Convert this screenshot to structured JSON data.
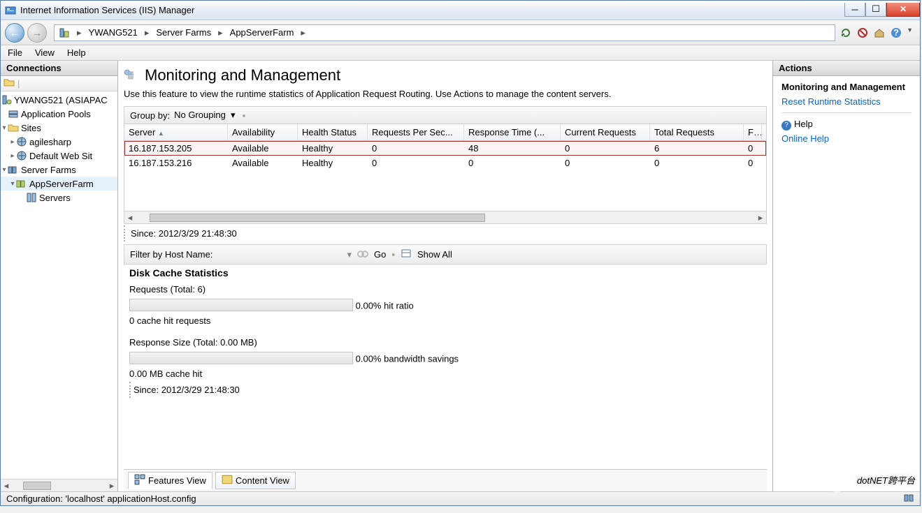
{
  "window": {
    "title": "Internet Information Services (IIS) Manager"
  },
  "breadcrumb": {
    "segments": [
      "YWANG521",
      "Server Farms",
      "AppServerFarm"
    ]
  },
  "menubar": {
    "file": "File",
    "view": "View",
    "help": "Help"
  },
  "connections": {
    "title": "Connections",
    "root": "YWANG521 (ASIAPAC",
    "app_pools": "Application Pools",
    "sites": "Sites",
    "site1": "agilesharp",
    "site2": "Default Web Sit",
    "server_farms": "Server Farms",
    "farm1": "AppServerFarm",
    "servers": "Servers"
  },
  "content": {
    "title": "Monitoring and Management",
    "subtitle": "Use this feature to view the runtime statistics of Application Request Routing. Use Actions to manage the content servers.",
    "group_by_label": "Group by:",
    "group_by_value": "No Grouping",
    "columns": [
      "Server",
      "Availability",
      "Health Status",
      "Requests Per Sec...",
      "Response Time (...",
      "Current Requests",
      "Total Requests",
      "Fai"
    ],
    "rows": [
      {
        "server": "16.187.153.205",
        "availability": "Available",
        "health": "Healthy",
        "rps": "0",
        "rt": "48",
        "current": "0",
        "total": "6",
        "fail": "0",
        "selected": true
      },
      {
        "server": "16.187.153.216",
        "availability": "Available",
        "health": "Healthy",
        "rps": "0",
        "rt": "0",
        "current": "0",
        "total": "0",
        "fail": "0",
        "selected": false
      }
    ],
    "since_label": "Since: 2012/3/29 21:48:30",
    "filter_label": "Filter by Host Name:",
    "go_label": "Go",
    "showall_label": "Show All",
    "diskcache": {
      "title": "Disk Cache Statistics",
      "requests_label": "Requests (Total: 6)",
      "hit_ratio": "0.00% hit ratio",
      "cache_hit_requests": "0 cache hit requests",
      "response_size_label": "Response Size (Total: 0.00 MB)",
      "bandwidth": "0.00% bandwidth savings",
      "mb_cache_hit": "0.00 MB cache hit",
      "since": "Since: 2012/3/29 21:48:30"
    },
    "features_view": "Features View",
    "content_view": "Content View"
  },
  "actions": {
    "title": "Actions",
    "heading": "Monitoring and Management",
    "reset": "Reset Runtime Statistics",
    "help": "Help",
    "online_help": "Online Help"
  },
  "statusbar": {
    "text": "Configuration: 'localhost' applicationHost.config"
  },
  "watermark": "dotNET跨平台"
}
